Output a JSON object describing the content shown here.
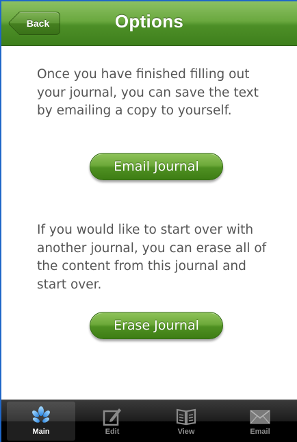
{
  "navbar": {
    "title": "Options",
    "back_label": "Back"
  },
  "content": {
    "email_paragraph": "Once you have finished filling out your journal, you can save the text by emailing a copy to yourself.",
    "email_button_label": "Email Journal",
    "erase_paragraph": "If you would like to start over with another journal, you can erase all of the content from this journal and start over.",
    "erase_button_label": "Erase Journal"
  },
  "tabbar": {
    "tabs": [
      {
        "label": "Main",
        "icon": "plant-icon",
        "selected": true
      },
      {
        "label": "Edit",
        "icon": "edit-icon",
        "selected": false
      },
      {
        "label": "View",
        "icon": "book-icon",
        "selected": false
      },
      {
        "label": "Email",
        "icon": "envelope-icon",
        "selected": false
      }
    ]
  },
  "colors": {
    "accent_green": "#5a9a2e",
    "paragraph_text": "#555555",
    "tabbar_selected_icon": "#6fb6ff"
  }
}
